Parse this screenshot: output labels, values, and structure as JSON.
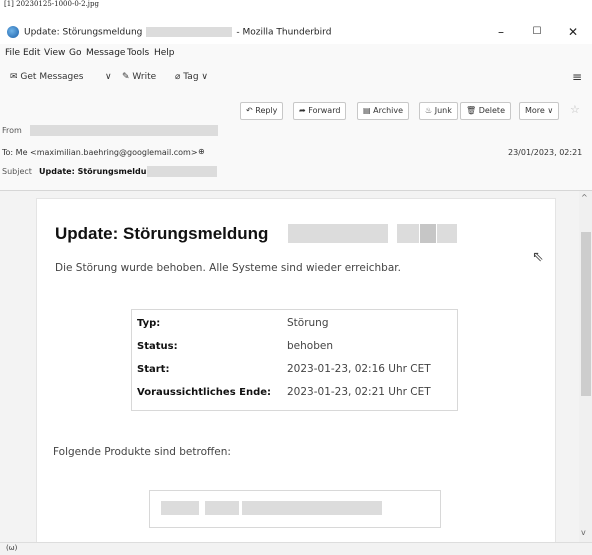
{
  "caption": "[1] 20230125-1000-0-2.jpg",
  "window": {
    "title_prefix": "Update: Störungsmeldung",
    "title_suffix": "- Mozilla Thunderbird",
    "minimize": "–",
    "maximize": "☐",
    "close": "✕"
  },
  "menu": {
    "file": "File",
    "edit": "Edit",
    "view": "View",
    "go": "Go",
    "message": "Message",
    "tools": "Tools",
    "help": "Help"
  },
  "toolbar": {
    "get_messages": "Get Messages",
    "write": "Write",
    "tag": "Tag",
    "hamburger": "≡"
  },
  "header": {
    "reply": "Reply",
    "forward": "Forward",
    "archive": "Archive",
    "junk": "Junk",
    "delete": "Delete",
    "more": "More",
    "from_label": "From",
    "to_text": "To: Me <maximilian.baehring@googlemail.com>",
    "date": "23/01/2023, 02:21",
    "subject_label": "Subject",
    "subject": "Update: Störungsmeldun"
  },
  "message": {
    "heading": "Update: Störungsmeldung",
    "intro": "Die Störung wurde behoben. Alle Systeme sind wieder erreichbar.",
    "info": [
      {
        "key": "Typ:",
        "value": "Störung"
      },
      {
        "key": "Status:",
        "value": "behoben"
      },
      {
        "key": "Start:",
        "value": "2023-01-23, 02:16 Uhr CET"
      },
      {
        "key": "Voraussichtliches Ende:",
        "value": "2023-01-23, 02:21 Uhr CET"
      }
    ],
    "products_label": "Folgende Produkte sind betroffen:"
  },
  "statusbar": {
    "icon": "(ω)"
  }
}
